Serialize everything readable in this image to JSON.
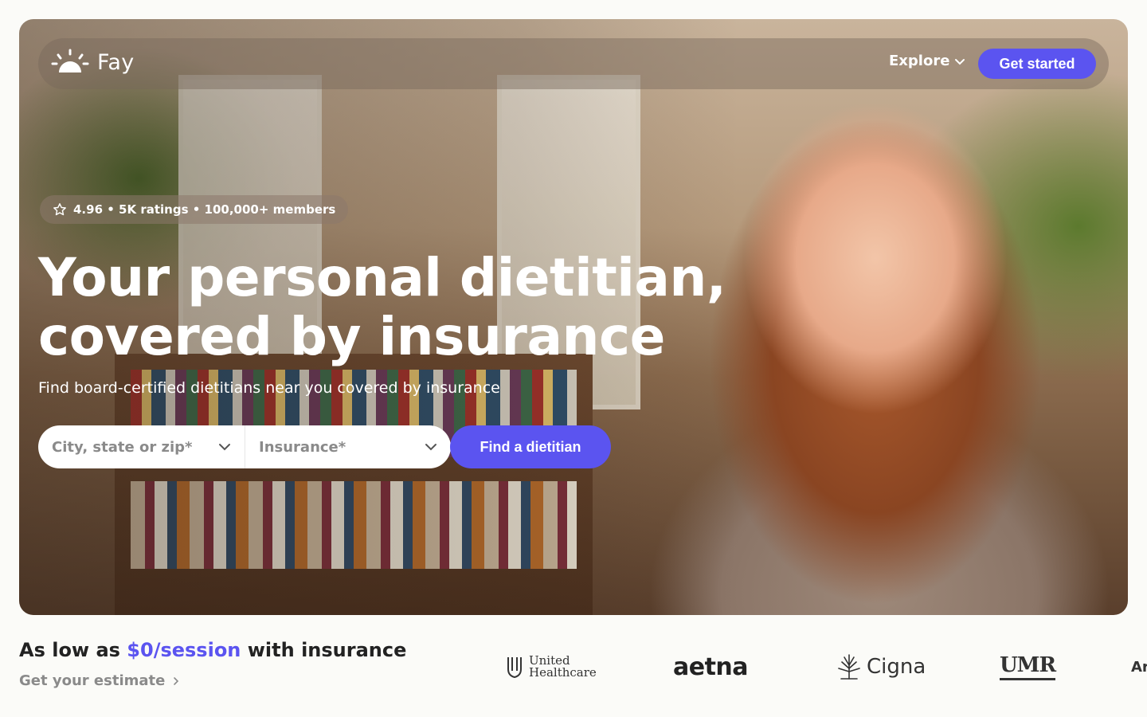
{
  "nav": {
    "brand": "Fay",
    "explore_label": "Explore",
    "cta_label": "Get started"
  },
  "hero": {
    "rating_text": "4.96 • 5K ratings • 100,000+  members",
    "headline_line1": "Your personal dietitian,",
    "headline_line2": "covered by insurance",
    "subheadline": "Find board-certified dietitians near you covered by insurance"
  },
  "search": {
    "location_placeholder": "City, state or zip*",
    "insurance_placeholder": "Insurance*",
    "submit_label": "Find a dietitian"
  },
  "promo": {
    "text_before": "As low as ",
    "price": "$0/session",
    "text_after": " with insurance",
    "estimate_link": "Get your estimate"
  },
  "insurers": {
    "united_line1": "United",
    "united_line2": "Healthcare",
    "aetna": "aetna",
    "cigna": "Cigna",
    "umr": "UMR",
    "partial": "Ar"
  },
  "colors": {
    "accent": "#5b54f0",
    "text_dark": "#222222",
    "text_muted": "#8a8a8a"
  },
  "icons": [
    "sun-logo-icon",
    "chevron-down-icon",
    "star-icon",
    "chevron-right-icon",
    "cigna-tree-icon",
    "uhc-shield-icon"
  ]
}
